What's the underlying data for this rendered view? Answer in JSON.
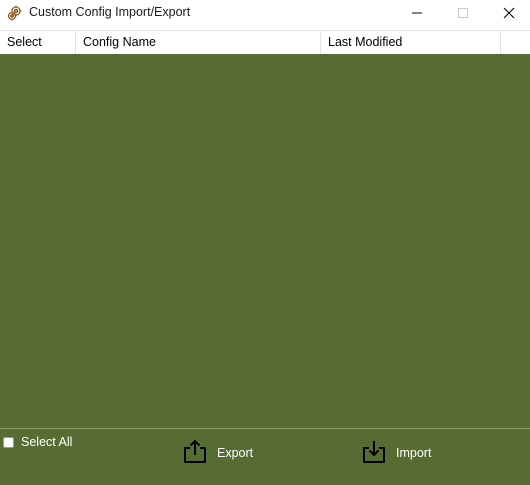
{
  "window": {
    "title": "Custom Config Import/Export",
    "icon": "gear-app-icon"
  },
  "table": {
    "columns": [
      "Select",
      "Config Name",
      "Last Modified"
    ],
    "rows": []
  },
  "footer": {
    "select_all_label": "Select All",
    "select_all_checked": false,
    "export_label": "Export",
    "import_label": "Import"
  },
  "colors": {
    "list_background": "#576c32",
    "footer_background": "#576c32",
    "footer_text": "#ffffff"
  }
}
